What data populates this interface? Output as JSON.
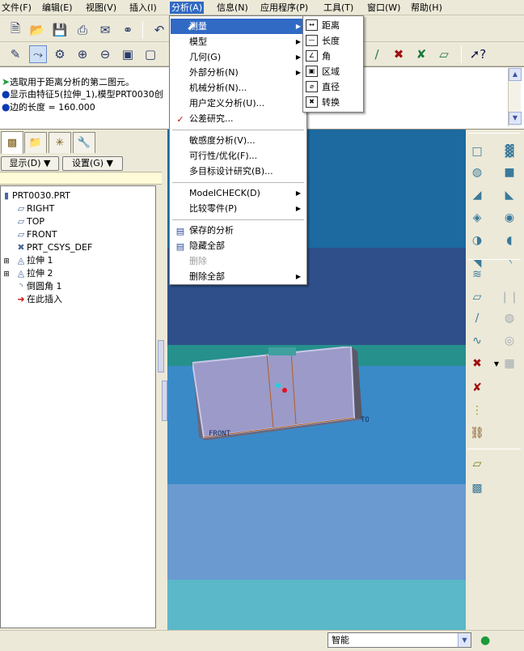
{
  "menubar": {
    "items": [
      {
        "label": "文件(F)"
      },
      {
        "label": "编辑(E)"
      },
      {
        "label": "视图(V)"
      },
      {
        "label": "插入(I)"
      },
      {
        "label": "分析(A)"
      },
      {
        "label": "信息(N)"
      },
      {
        "label": "应用程序(P)"
      },
      {
        "label": "工具(T)"
      },
      {
        "label": "窗口(W)"
      },
      {
        "label": "帮助(H)"
      }
    ]
  },
  "messages": [
    {
      "text": "选取用于距离分析的第二图元。"
    },
    {
      "text": "显示由特征5(拉伸_1),模型PRT0030创"
    },
    {
      "text": "边的长度 = 160.000"
    }
  ],
  "left_panel": {
    "display_button": "显示(D) ▼",
    "settings_button": "设置(G) ▼",
    "tree": [
      {
        "label": "PRT0030.PRT"
      },
      {
        "label": "RIGHT"
      },
      {
        "label": "TOP"
      },
      {
        "label": "FRONT"
      },
      {
        "label": "PRT_CSYS_DEF"
      },
      {
        "label": "拉伸 1"
      },
      {
        "label": "拉伸 2"
      },
      {
        "label": "倒圆角 1"
      },
      {
        "label": "在此插入"
      }
    ]
  },
  "analysis_menu": {
    "items": [
      {
        "label": "测量"
      },
      {
        "label": "模型"
      },
      {
        "label": "几何(G)"
      },
      {
        "label": "外部分析(N)"
      },
      {
        "label": "机械分析(N)..."
      },
      {
        "label": "用户定义分析(U)..."
      },
      {
        "label": "公差研究..."
      },
      {
        "label": "敏感度分析(V)..."
      },
      {
        "label": "可行性/优化(F)..."
      },
      {
        "label": "多目标设计研究(B)..."
      },
      {
        "label": "ModelCHECK(D)"
      },
      {
        "label": "比较零件(P)"
      },
      {
        "label": "保存的分析"
      },
      {
        "label": "隐藏全部"
      },
      {
        "label": "删除"
      },
      {
        "label": "删除全部"
      }
    ]
  },
  "measure_submenu": {
    "items": [
      {
        "label": "距离"
      },
      {
        "label": "长度"
      },
      {
        "label": "角"
      },
      {
        "label": "区域"
      },
      {
        "label": "直径"
      },
      {
        "label": "转换"
      }
    ]
  },
  "viewport": {
    "datum_labels": {
      "top": "TOP",
      "front": "FRONT"
    }
  },
  "statusbar": {
    "filter_value": "智能"
  },
  "colors": {
    "accent": "#316ac5",
    "viewport_top": "#1c6aa0",
    "viewport_mid": "#2e4f8a",
    "part": "#9c9ac8"
  }
}
